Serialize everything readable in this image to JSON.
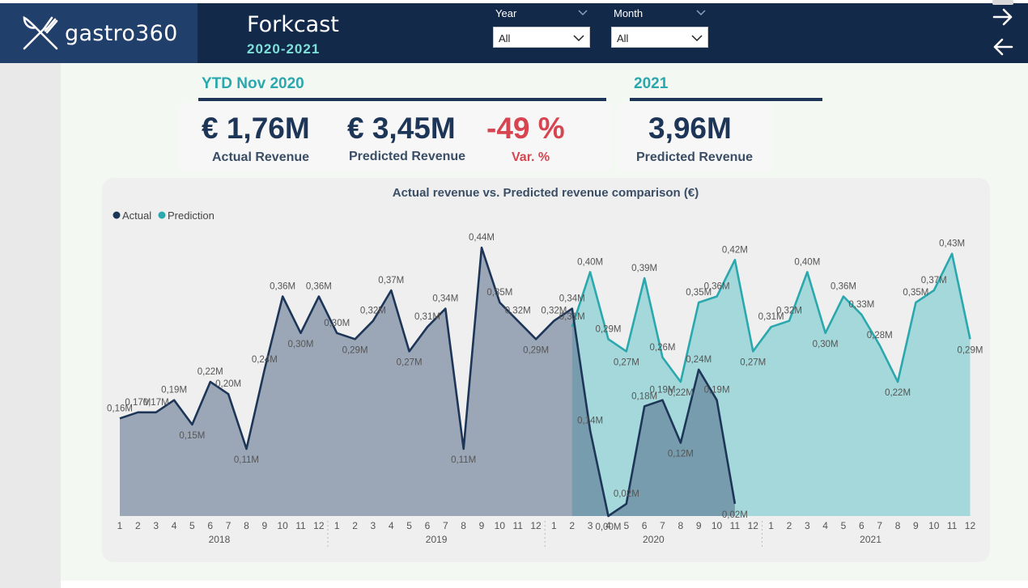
{
  "header": {
    "brand": "gastro360",
    "title": "Forkcast",
    "subtitle": "2020-2021"
  },
  "filters": {
    "year": {
      "label": "Year",
      "value": "All"
    },
    "month": {
      "label": "Month",
      "value": "All"
    }
  },
  "nav": {
    "forward_icon": "arrow-right-icon",
    "back_icon": "arrow-left-icon"
  },
  "sections": {
    "ytd_title": "YTD Nov 2020",
    "next_title": "2021"
  },
  "kpis": {
    "actual": {
      "value": "€ 1,76M",
      "label": "Actual Revenue"
    },
    "predicted": {
      "value": "€ 3,45M",
      "label": "Predicted Revenue"
    },
    "variance": {
      "value": "-49 %",
      "label": "Var. %"
    },
    "next_year": {
      "value": "3,96M",
      "label": "Predicted Revenue"
    }
  },
  "colors": {
    "navy": "#13294a",
    "actual": "#1d3557",
    "prediction": "#2aa8ad",
    "negative": "#d64550",
    "accent": "#2aa8ad"
  },
  "chart_data": {
    "type": "area",
    "title": "Actual revenue vs. Predicted revenue comparison (€)",
    "legend_position": "top-left",
    "grid": false,
    "unit": "M",
    "years": [
      "2018",
      "2019",
      "2020",
      "2021"
    ],
    "months": [
      "1",
      "2",
      "3",
      "4",
      "5",
      "6",
      "7",
      "8",
      "9",
      "10",
      "11",
      "12"
    ],
    "ylim": [
      0,
      0.48
    ],
    "series": [
      {
        "name": "Actual",
        "color": "#1d3557",
        "start_index": 0,
        "values": [
          0.16,
          0.17,
          0.17,
          0.19,
          0.15,
          0.22,
          0.2,
          0.11,
          0.24,
          0.36,
          0.3,
          0.36,
          0.3,
          0.29,
          0.32,
          0.37,
          0.27,
          0.31,
          0.34,
          0.11,
          0.44,
          0.35,
          0.32,
          0.29,
          0.32,
          0.34,
          0.14,
          0.0,
          0.02,
          0.18,
          0.19,
          0.12,
          0.24,
          0.19,
          0.02
        ],
        "labels": [
          "0,16M",
          "0,17M",
          "0,17M",
          "0,19M",
          "0,15M",
          "0,22M",
          "0,20M",
          "0,11M",
          "0,24M",
          "0,36M",
          "0,30M",
          "0,36M",
          "0,30M",
          "0,29M",
          "0,32M",
          "0,37M",
          "0,27M",
          "0,31M",
          "0,34M",
          "0,11M",
          "0,44M",
          "0,35M",
          "0,32M",
          "0,29M",
          "0,32M",
          "0,34M",
          "0,14M",
          "0,00M",
          "0,02M",
          "0,18M",
          "0,19M",
          "0,12M",
          "0,24M",
          "0,19M",
          "0,02M"
        ]
      },
      {
        "name": "Prediction",
        "color": "#2aa8ad",
        "start_index": 25,
        "values": [
          0.31,
          0.4,
          0.29,
          0.27,
          0.39,
          0.26,
          0.22,
          0.35,
          0.36,
          0.42,
          0.27,
          0.31,
          0.32,
          0.4,
          0.3,
          0.36,
          0.33,
          0.28,
          0.22,
          0.35,
          0.37,
          0.43,
          0.29
        ],
        "labels": [
          "0,31M",
          "0,40M",
          "0,29M",
          "0,27M",
          "0,39M",
          "0,26M",
          "0,22M",
          "0,35M",
          "0,36M",
          "0,42M",
          "0,27M",
          "0,31M",
          "0,32M",
          "0,40M",
          "0,30M",
          "0,36M",
          "0,33M",
          "0,28M",
          "0,22M",
          "0,35M",
          "0,37M",
          "0,43M",
          "0,29M"
        ]
      }
    ]
  }
}
